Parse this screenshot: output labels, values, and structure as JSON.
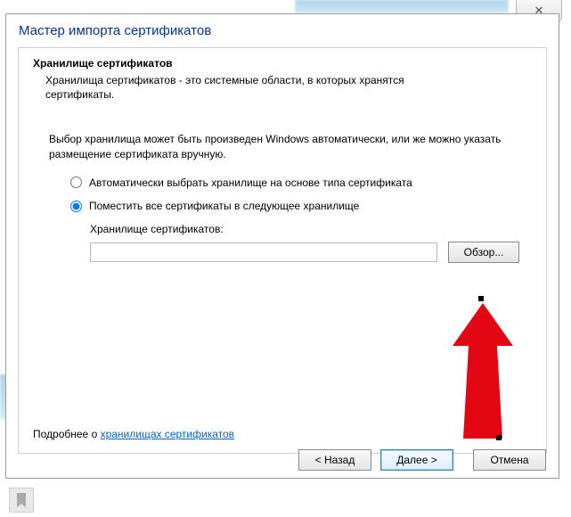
{
  "window": {
    "close_glyph": "✕"
  },
  "wizard": {
    "title": "Мастер импорта сертификатов",
    "section_heading": "Хранилище сертификатов",
    "section_desc": "Хранилища сертификатов - это системные области, в которых хранятся сертификаты.",
    "intro": "Выбор хранилища может быть произведен Windows автоматически, или же можно указать размещение сертификата вручную.",
    "radio_auto": "Автоматически выбрать хранилище на основе типа сертификата",
    "radio_manual": "Поместить все сертификаты в следующее хранилище",
    "store_label": "Хранилище сертификатов:",
    "store_value": "",
    "browse_label": "Обзор...",
    "learn_prefix": "Подробнее о ",
    "learn_link": "хранилищах сертификатов"
  },
  "buttons": {
    "back": "< Назад",
    "next": "Далее >",
    "cancel": "Отмена"
  }
}
